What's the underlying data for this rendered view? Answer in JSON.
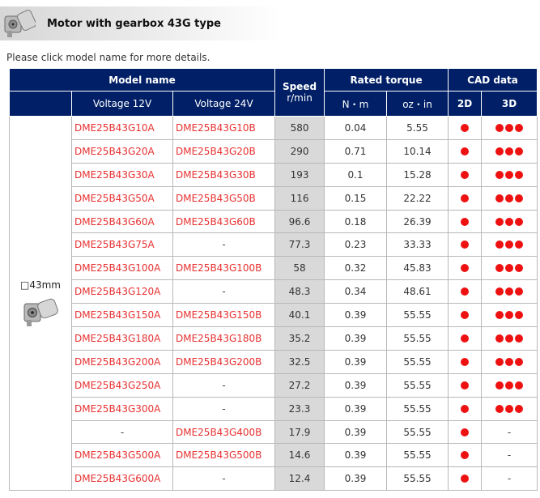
{
  "header": {
    "title": "Motor with gearbox 43G type",
    "logo_icon": "gearmotor-photo-icon"
  },
  "instruction": "Please click model name for more details.",
  "table": {
    "headers": {
      "model_name": "Model name",
      "speed_line1": "Speed",
      "speed_line2": "r/min",
      "rated_torque": "Rated torque",
      "cad_data": "CAD data",
      "voltage_12v": "Voltage 12V",
      "voltage_24v": "Voltage 24V",
      "nm": "N・m",
      "ozin": "oz・in",
      "cad_2d": "2D",
      "cad_3d": "3D"
    },
    "size_label": "□43mm",
    "size_icon": "gearmotor-photo-icon",
    "colors": {
      "header_bg": "#001f66",
      "link": "#e83030",
      "dot": "#ee1111",
      "speed_bg": "#d9d9d9"
    },
    "rows": [
      {
        "v12": "DME25B43G10A",
        "v24": "DME25B43G10B",
        "speed": "580",
        "nm": "0.04",
        "ozin": "5.55",
        "cad2d": true,
        "cad3d": true
      },
      {
        "v12": "DME25B43G20A",
        "v24": "DME25B43G20B",
        "speed": "290",
        "nm": "0.71",
        "ozin": "10.14",
        "cad2d": true,
        "cad3d": true
      },
      {
        "v12": "DME25B43G30A",
        "v24": "DME25B43G30B",
        "speed": "193",
        "nm": "0.1",
        "ozin": "15.28",
        "cad2d": true,
        "cad3d": true
      },
      {
        "v12": "DME25B43G50A",
        "v24": "DME25B43G50B",
        "speed": "116",
        "nm": "0.15",
        "ozin": "22.22",
        "cad2d": true,
        "cad3d": true
      },
      {
        "v12": "DME25B43G60A",
        "v24": "DME25B43G60B",
        "speed": "96.6",
        "nm": "0.18",
        "ozin": "26.39",
        "cad2d": true,
        "cad3d": true
      },
      {
        "v12": "DME25B43G75A",
        "v24": "-",
        "speed": "77.3",
        "nm": "0.23",
        "ozin": "33.33",
        "cad2d": true,
        "cad3d": true
      },
      {
        "v12": "DME25B43G100A",
        "v24": "DME25B43G100B",
        "speed": "58",
        "nm": "0.32",
        "ozin": "45.83",
        "cad2d": true,
        "cad3d": true
      },
      {
        "v12": "DME25B43G120A",
        "v24": "-",
        "speed": "48.3",
        "nm": "0.34",
        "ozin": "48.61",
        "cad2d": true,
        "cad3d": true
      },
      {
        "v12": "DME25B43G150A",
        "v24": "DME25B43G150B",
        "speed": "40.1",
        "nm": "0.39",
        "ozin": "55.55",
        "cad2d": true,
        "cad3d": true
      },
      {
        "v12": "DME25B43G180A",
        "v24": "DME25B43G180B",
        "speed": "35.2",
        "nm": "0.39",
        "ozin": "55.55",
        "cad2d": true,
        "cad3d": true
      },
      {
        "v12": "DME25B43G200A",
        "v24": "DME25B43G200B",
        "speed": "32.5",
        "nm": "0.39",
        "ozin": "55.55",
        "cad2d": true,
        "cad3d": true
      },
      {
        "v12": "DME25B43G250A",
        "v24": "-",
        "speed": "27.2",
        "nm": "0.39",
        "ozin": "55.55",
        "cad2d": true,
        "cad3d": true
      },
      {
        "v12": "DME25B43G300A",
        "v24": "-",
        "speed": "23.3",
        "nm": "0.39",
        "ozin": "55.55",
        "cad2d": true,
        "cad3d": true
      },
      {
        "v12": "-",
        "v24": "DME25B43G400B",
        "speed": "17.9",
        "nm": "0.39",
        "ozin": "55.55",
        "cad2d": true,
        "cad3d": false
      },
      {
        "v12": "DME25B43G500A",
        "v24": "DME25B43G500B",
        "speed": "14.6",
        "nm": "0.39",
        "ozin": "55.55",
        "cad2d": true,
        "cad3d": false
      },
      {
        "v12": "DME25B43G600A",
        "v24": "-",
        "speed": "12.4",
        "nm": "0.39",
        "ozin": "55.55",
        "cad2d": true,
        "cad3d": false
      }
    ],
    "dash": "-"
  }
}
